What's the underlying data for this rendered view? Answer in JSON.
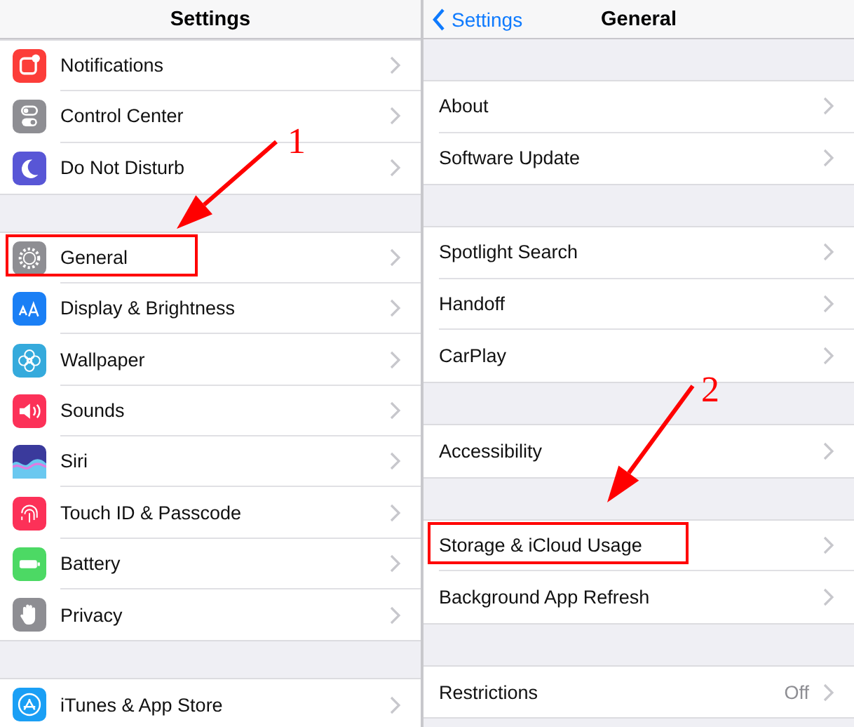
{
  "panels": [
    {
      "title": "Settings",
      "groups": [
        [
          {
            "label": "Notifications",
            "kind": "notifications",
            "color": "#fc3d39",
            "highlighted": false
          },
          {
            "label": "Control Center",
            "kind": "toggles",
            "color": "#8e8e93",
            "highlighted": false
          },
          {
            "label": "Do Not Disturb",
            "kind": "moon",
            "color": "#5856d6",
            "highlighted": false
          }
        ],
        [
          {
            "label": "General",
            "kind": "gear",
            "color": "#8e8e93",
            "highlighted": true
          },
          {
            "label": "Display & Brightness",
            "kind": "letters",
            "color": "#1a7ff5",
            "highlighted": false
          },
          {
            "label": "Wallpaper",
            "kind": "flower",
            "color": "#35aadc",
            "highlighted": false
          },
          {
            "label": "Sounds",
            "kind": "speaker",
            "color": "#fc3158",
            "highlighted": false
          },
          {
            "label": "Siri",
            "kind": "siri",
            "color": "#3a3a9c",
            "highlighted": false
          },
          {
            "label": "Touch ID & Passcode",
            "kind": "fingerprint",
            "color": "#fc3158",
            "highlighted": false
          },
          {
            "label": "Battery",
            "kind": "battery",
            "color": "#4cd964",
            "highlighted": false
          },
          {
            "label": "Privacy",
            "kind": "hand",
            "color": "#8e8e93",
            "highlighted": false
          }
        ],
        [
          {
            "label": "iTunes & App Store",
            "kind": "appstore",
            "color": "#1a9ff5",
            "highlighted": false
          }
        ]
      ]
    },
    {
      "title": "General",
      "back": "Settings",
      "groups": [
        [
          {
            "label": "About",
            "highlighted": false
          },
          {
            "label": "Software Update",
            "highlighted": false
          }
        ],
        [
          {
            "label": "Spotlight Search",
            "highlighted": false
          },
          {
            "label": "Handoff",
            "highlighted": false
          },
          {
            "label": "CarPlay",
            "highlighted": false
          }
        ],
        [
          {
            "label": "Accessibility",
            "highlighted": false
          }
        ],
        [
          {
            "label": "Storage & iCloud Usage",
            "highlighted": true
          },
          {
            "label": "Background App Refresh",
            "highlighted": false
          }
        ],
        [
          {
            "label": "Restrictions",
            "value": "Off",
            "highlighted": false
          }
        ]
      ]
    }
  ],
  "annotations": [
    "1",
    "2"
  ]
}
